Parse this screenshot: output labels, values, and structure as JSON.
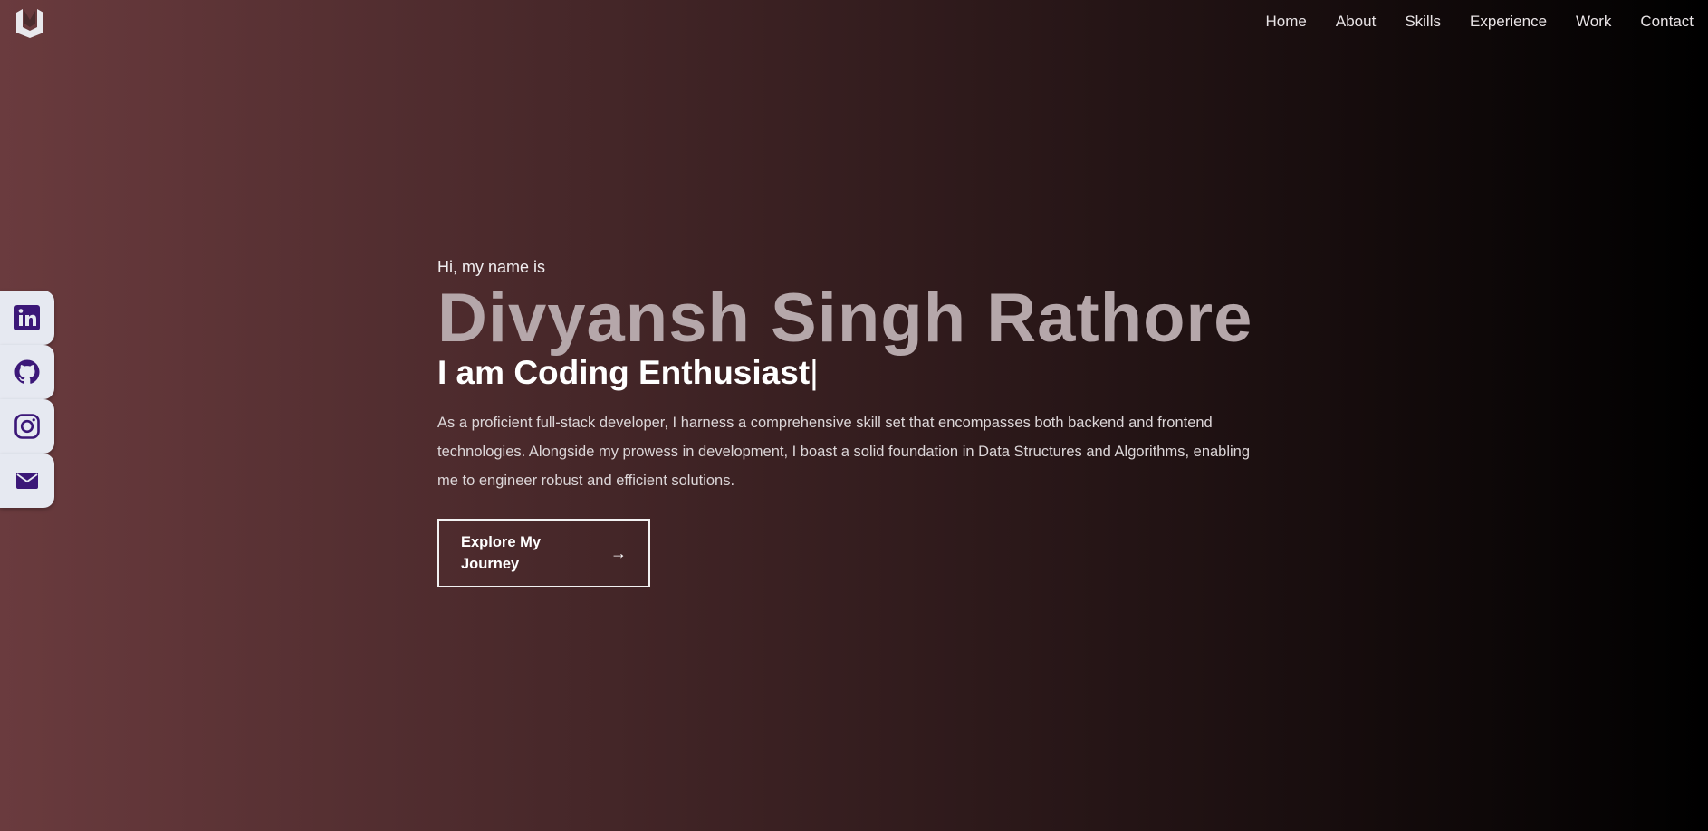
{
  "theme": {
    "background_start": "#6a3b3e",
    "background_end": "#000000",
    "accent_icon": "#3b1778",
    "social_bg": "#e6e9f1"
  },
  "header": {
    "logo_icon": "lm-monogram-logo",
    "nav": [
      {
        "label": "Home"
      },
      {
        "label": "About"
      },
      {
        "label": "Skills"
      },
      {
        "label": "Experience"
      },
      {
        "label": "Work"
      },
      {
        "label": "Contact"
      }
    ]
  },
  "social": [
    {
      "icon": "linkedin-icon"
    },
    {
      "icon": "github-icon"
    },
    {
      "icon": "instagram-icon"
    },
    {
      "icon": "mail-icon"
    }
  ],
  "hero": {
    "greeting": "Hi, my name is",
    "name": "Divyansh Singh Rathore",
    "tagline": "I am Coding Enthusiast",
    "cursor": "|",
    "description": "As a proficient full-stack developer, I harness a comprehensive skill set that encompasses both backend and frontend technologies. Alongside my prowess in development, I boast a solid foundation in Data Structures and Algorithms, enabling me to engineer robust and efficient solutions.",
    "cta_label": "Explore My Journey",
    "cta_arrow": "→"
  }
}
